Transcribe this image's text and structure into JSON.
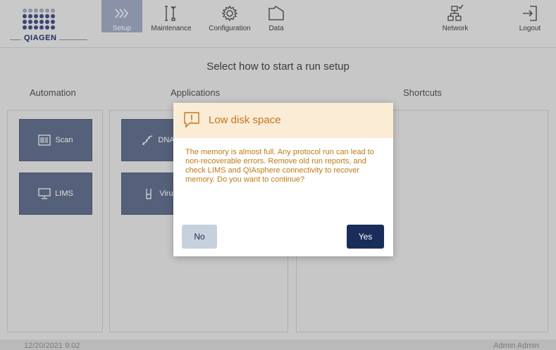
{
  "brand": {
    "logo_text": "QIAGEN"
  },
  "nav": {
    "setup": "Setup",
    "maintenance": "Maintenance",
    "configuration": "Configuration",
    "data": "Data",
    "network": "Network",
    "logout": "Logout"
  },
  "main": {
    "title": "Select how to start a run setup",
    "columns": {
      "automation": "Automation",
      "applications": "Applications",
      "shortcuts": "Shortcuts"
    },
    "automation_tiles": [
      {
        "label": "Scan",
        "icon": "barcode-scan-icon"
      },
      {
        "label": "LIMS",
        "icon": "monitor-icon"
      }
    ],
    "application_tiles": [
      {
        "label": "DNA",
        "icon": "dna-icon"
      },
      {
        "label": "Viru",
        "icon": "tube-icon"
      }
    ]
  },
  "status": {
    "datetime": "12/20/2021 9:02",
    "user": "Admin Admin"
  },
  "dialog": {
    "title": "Low disk space",
    "icon": "warning-icon",
    "message": "The memory is almost full. Any protocol run can lead to non-recoverable errors. Remove old run reports, and check LIMS and QIAsphere connectivity to recover memory. Do you want to continue?",
    "no_label": "No",
    "yes_label": "Yes"
  },
  "colors": {
    "active_tab": "#9aa5bf",
    "tile": "#5b6a88",
    "dialog_header": "#fbecd6",
    "warning_text": "#c7741c",
    "primary_button": "#1a2d5a",
    "secondary_button": "#c7d1de"
  }
}
